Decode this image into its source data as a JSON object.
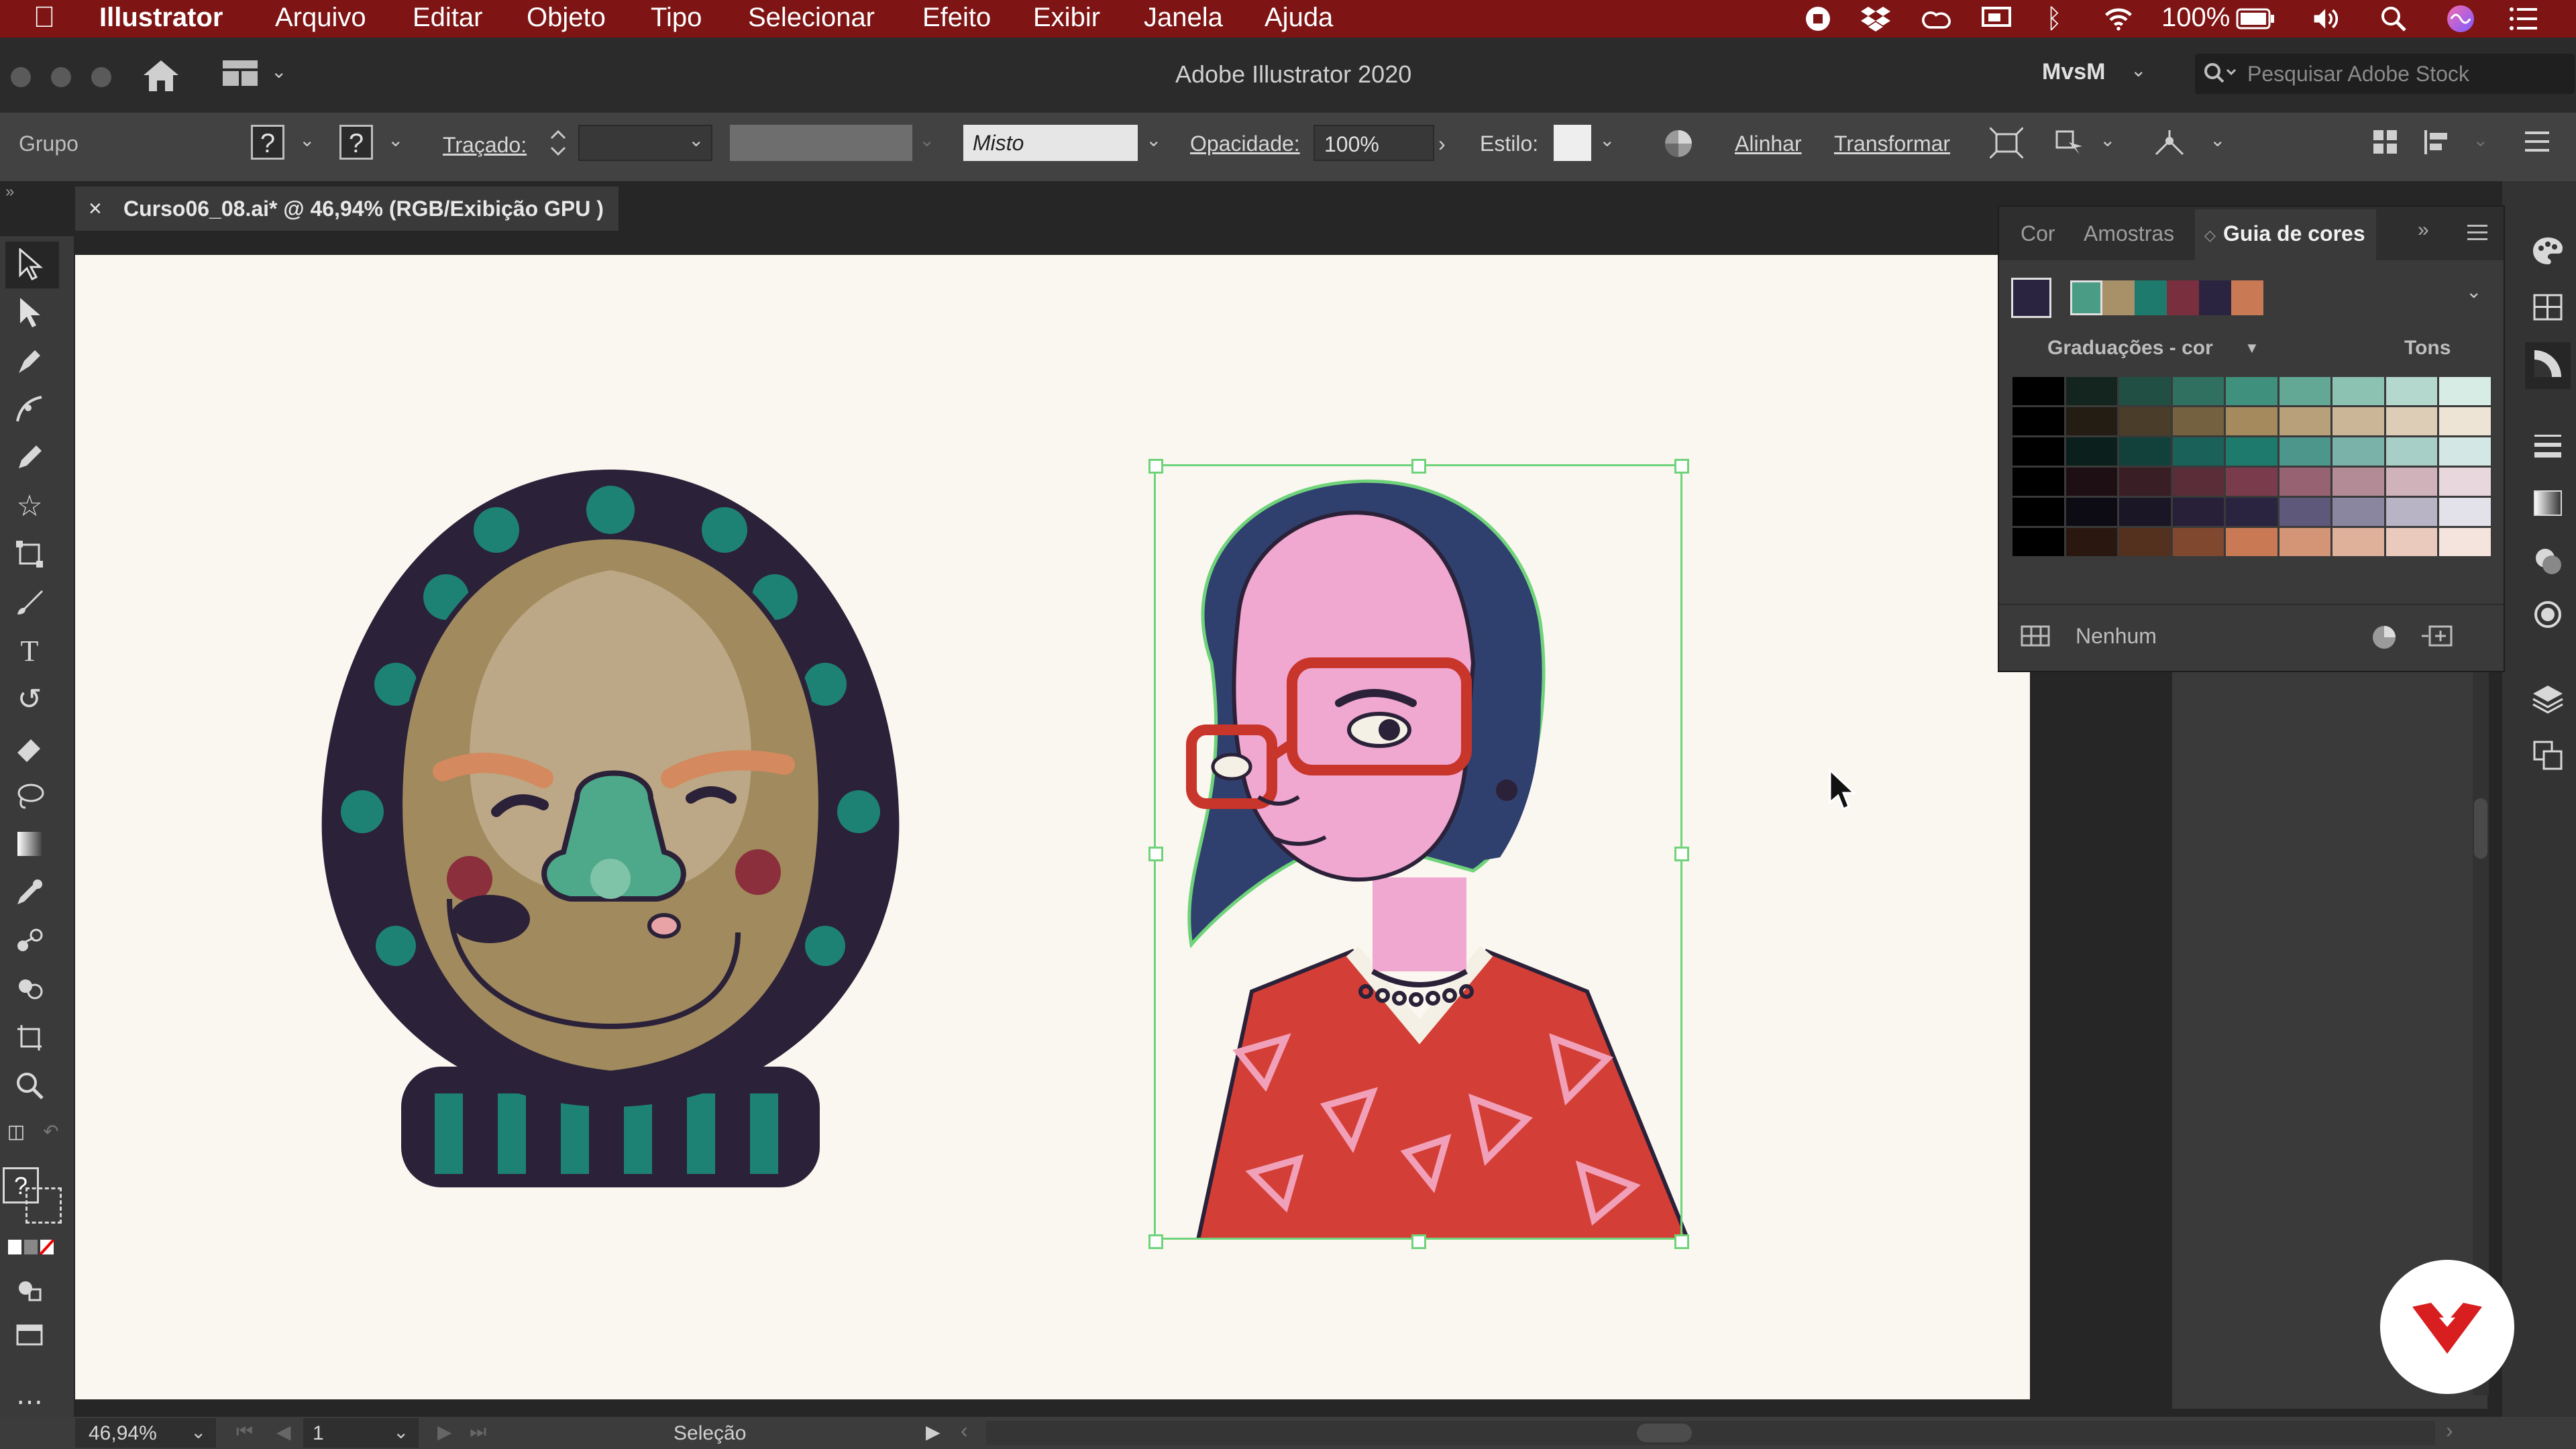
{
  "menubar": {
    "apple_icon": "apple-icon",
    "app_name": "Illustrator",
    "items": [
      "Arquivo",
      "Editar",
      "Objeto",
      "Tipo",
      "Selecionar",
      "Efeito",
      "Exibir",
      "Janela",
      "Ajuda"
    ],
    "battery": "100%"
  },
  "titlebar": {
    "title": "Adobe Illustrator 2020",
    "workspace": "MvsM",
    "search_placeholder": "Pesquisar Adobe Stock"
  },
  "controlbar": {
    "selection_type": "Grupo",
    "fill_mark": "?",
    "stroke_mark": "?",
    "stroke_label": "Traçado:",
    "brush_value": "Misto",
    "opacity_label": "Opacidade:",
    "opacity_value": "100%",
    "style_label": "Estilo:",
    "align_label": "Alinhar",
    "transform_label": "Transformar"
  },
  "document": {
    "tab_title": "Curso06_08.ai* @ 46,94% (RGB/Exibição GPU )",
    "close_glyph": "×"
  },
  "panel": {
    "tabs": [
      "Cor",
      "Amostras",
      "Guia de cores"
    ],
    "active_tab": "Guia de cores",
    "gradations_label": "Graduações - cor",
    "tones_label": "Tons",
    "footer_label": "Nenhum",
    "harmony_colors": [
      "#4a9c84",
      "#a89068",
      "#1f7a6e",
      "#7a2f3e",
      "#2a2440",
      "#c97a55"
    ],
    "grid": [
      [
        "#000000",
        "#142520",
        "#214f43",
        "#2f7060",
        "#3f907c",
        "#62a894",
        "#8cc2b2",
        "#b4d8cd",
        "#d8ece6"
      ],
      [
        "#000000",
        "#231d14",
        "#4a3d2a",
        "#74613f",
        "#a48a5d",
        "#b8a07a",
        "#cbb798",
        "#ddcdb6",
        "#eee4d6"
      ],
      [
        "#000000",
        "#0b1f1d",
        "#12403b",
        "#1a6259",
        "#1f7a6e",
        "#4d968c",
        "#7ab2aa",
        "#a8cec8",
        "#d3e7e4"
      ],
      [
        "#000000",
        "#1d0f13",
        "#3a1e26",
        "#5a2d39",
        "#7a3c4c",
        "#976372",
        "#b38b96",
        "#d0b2bb",
        "#e8d8dd"
      ],
      [
        "#000000",
        "#0d0b13",
        "#1a1626",
        "#282039",
        "#2a2440",
        "#5e587a",
        "#8b86a0",
        "#b8b4c6",
        "#e3e1ea"
      ],
      [
        "#000000",
        "#2a1810",
        "#54301f",
        "#80482f",
        "#c97a55",
        "#d49577",
        "#dfb09a",
        "#e9cabd",
        "#f4e4dd"
      ]
    ]
  },
  "status": {
    "zoom": "46,94%",
    "artboard_number": "1",
    "tool_name": "Seleção"
  }
}
